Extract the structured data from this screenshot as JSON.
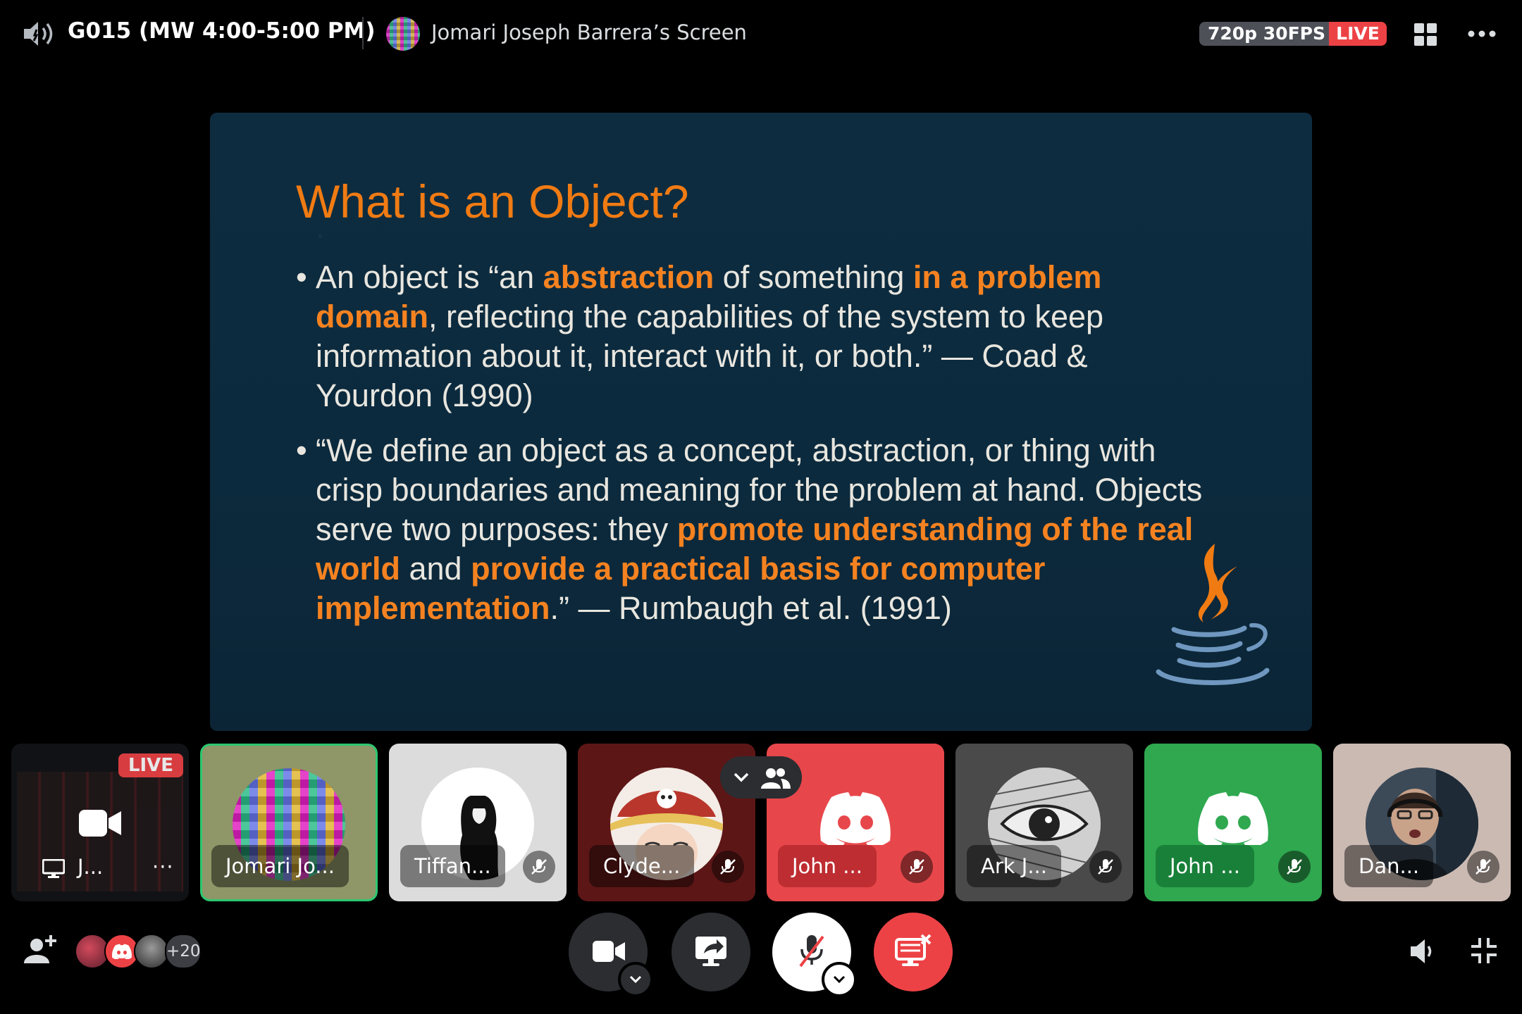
{
  "top_bar": {
    "channel_name": "G015 (MW 4:00-5:00 PM)",
    "screen_title": "Jomari Joseph Barrera’s Screen",
    "quality": "720p 30FPS",
    "live": "LIVE"
  },
  "slide": {
    "title": "What is an Object?",
    "bullet_symbol": "•",
    "bullet1": {
      "p1": "An object is “an ",
      "h1": "abstraction",
      "p2": " of something ",
      "h2": "in a problem domain",
      "p3": ", reflecting the capabilities of the system to keep information about it, interact with it, or both.” — Coad & Yourdon (1990)"
    },
    "bullet2": {
      "p1": "“We define an object as a concept, abstraction, or thing with crisp boundaries and meaning for the problem at hand. Objects serve two purposes: they ",
      "h1": "promote understanding of the real world",
      "p2": " and ",
      "h2": "provide a practical basis for computer implementation",
      "p3": ".” — Rumbaugh et al. (1991)"
    }
  },
  "participants": {
    "stream_tile": {
      "live": "LIVE",
      "name": "J...",
      "more": "···"
    },
    "tiles": [
      {
        "name": "Jomari Jo..."
      },
      {
        "name": "Tiffan..."
      },
      {
        "name": "Clyde..."
      },
      {
        "name": "John ..."
      },
      {
        "name": "Ark J..."
      },
      {
        "name": "John ..."
      },
      {
        "name": "Dan..."
      }
    ]
  },
  "bottom_bar": {
    "extra_participants": "+20"
  },
  "colors": {
    "live_red": "#ed4245",
    "speaking_green": "#2dc770",
    "slide_accent": "#f58220",
    "slide_bg": "#0e2c40"
  },
  "icons": [
    "speaker-icon",
    "grid-icon",
    "more-icon",
    "camera-icon",
    "screen-share-icon",
    "mic-muted-icon",
    "leave-call-icon",
    "volume-icon",
    "shrink-icon",
    "add-user-icon",
    "discord-icon",
    "java-logo"
  ]
}
